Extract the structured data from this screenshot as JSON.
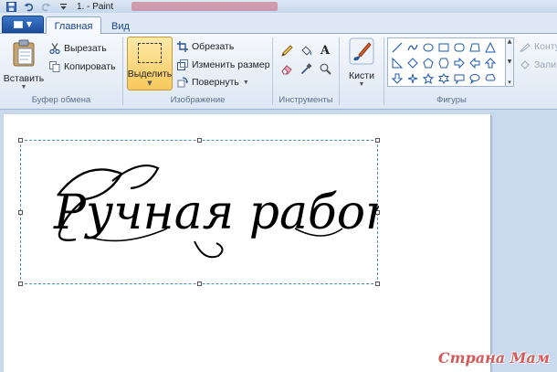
{
  "titlebar": {
    "title": "1. - Paint",
    "quick_access_icons": [
      "save-icon",
      "undo-icon",
      "redo-icon",
      "customize-icon"
    ]
  },
  "tabs": {
    "file_menu_icon": "file-menu-icon",
    "items": [
      {
        "label": "Главная",
        "active": true
      },
      {
        "label": "Вид",
        "active": false
      }
    ]
  },
  "ribbon": {
    "clipboard": {
      "paste_label": "Вставить",
      "cut_label": "Вырезать",
      "copy_label": "Копировать",
      "group_label": "Буфер обмена"
    },
    "image": {
      "select_label": "Выделить",
      "crop_label": "Обрезать",
      "resize_label": "Изменить размер",
      "rotate_label": "Повернуть",
      "group_label": "Изображение"
    },
    "tools": {
      "group_label": "Инструменты",
      "items": [
        "pencil-icon",
        "fill-icon",
        "text-icon",
        "eraser-icon",
        "color-picker-icon",
        "magnifier-icon"
      ]
    },
    "brushes": {
      "label": "Кисти"
    },
    "shapes": {
      "group_label": "Фигуры",
      "outline_label": "Конту",
      "fill_label": "Зали"
    }
  },
  "canvas": {
    "content_text": "Ручная работа"
  },
  "watermark": "Страна Мам"
}
